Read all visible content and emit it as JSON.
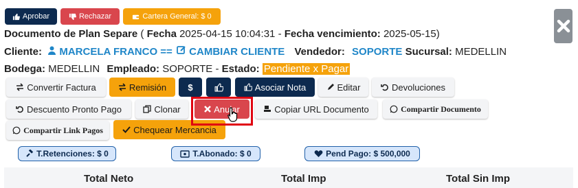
{
  "top_actions": {
    "approve": "Aprobar",
    "reject": "Rechazar",
    "general_wallet": "Cartera General: $ 0"
  },
  "document": {
    "title_prefix": "Documento de Plan Separe",
    "date_label": "Fecha",
    "date_value": "2025-04-15 10:04:31",
    "due_label": "Fecha vencimiento:",
    "due_value": "2025-05-15",
    "client_label": "Cliente:",
    "client_name": "MARCELA FRANCO ==",
    "change_client": "CAMBIAR CLIENTE",
    "seller_label": "Vendedor:",
    "seller_value": "SOPORTE",
    "branch_label": "Sucursal:",
    "branch_value": "MEDELLIN",
    "warehouse_label": "Bodega:",
    "warehouse_value": "MEDELLIN",
    "employee_label": "Empleado:",
    "employee_value": "SOPORTE",
    "status_label": "Estado:",
    "status_value": "Pendiente x Pagar"
  },
  "toolbar": {
    "convert_invoice": "Convertir Factura",
    "remission": "Remisión",
    "dollar": "$",
    "associate_note": "Asociar Nota",
    "edit": "Editar",
    "returns": "Devoluciones",
    "early_payment": "Descuento Pronto Pago",
    "clone": "Clonar",
    "cancel": "Anular",
    "copy_url": "Copiar URL Documento",
    "share_document": "Compartir Documento",
    "share_payment_link": "Compartir Link Pagos",
    "check_goods": "Chequear Mercancia"
  },
  "summary": {
    "withholdings": "T.Retenciones: $ 0",
    "paid": "T.Abonado: $ 0",
    "pending": "Pend Pago: $ 500,000"
  },
  "totals": {
    "net": "Total Neto",
    "tax": "Total Imp",
    "no_tax": "Total Sin Imp"
  },
  "colors": {
    "dark": "#0d2a4f",
    "red": "#d9464d",
    "orange": "#f5a20b",
    "link": "#1f86c8",
    "highlight": "#e00010"
  }
}
